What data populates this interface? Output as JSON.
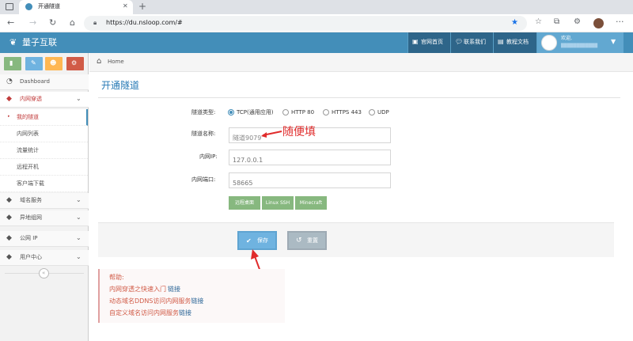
{
  "browser": {
    "tab_title": "开通隧道",
    "url": "https://du.nsloop.com/#"
  },
  "header": {
    "brand": "量子互联",
    "links": [
      "官网首页",
      "联系我们",
      "教程文档"
    ],
    "welcome": "欢迎,",
    "username": "████████████"
  },
  "sidebar": {
    "items": [
      {
        "label": "Dashboard"
      },
      {
        "label": "内网穿透"
      },
      {
        "label": "域名服务"
      },
      {
        "label": "异地组网"
      },
      {
        "label": "公网 IP"
      },
      {
        "label": "用户中心"
      }
    ],
    "subitems": [
      "我的隧道",
      "内网列表",
      "流量统计",
      "远程开机",
      "客户端下载"
    ]
  },
  "breadcrumb": {
    "home": "Home"
  },
  "page": {
    "title": "开通隧道"
  },
  "form": {
    "type_label": "隧道类型:",
    "types": [
      "TCP(通用应用)",
      "HTTP 80",
      "HTTPS 443",
      "UDP"
    ],
    "name_label": "隧道名称:",
    "name_value": "隧道9079",
    "ip_label": "内网IP:",
    "ip_placeholder": "127.0.0.1",
    "port_label": "内网端口:",
    "port_placeholder": "58665",
    "presets": [
      "远程桌面",
      "Linux SSH",
      "Minecraft"
    ],
    "save": "保存",
    "reset": "重置"
  },
  "annotation": {
    "text": "随便填"
  },
  "help": {
    "title": "帮助:",
    "lines": [
      {
        "text": "内网穿透之快速入门",
        "link": "链接"
      },
      {
        "text": "动态域名DDNS访问内网服务",
        "link": "链接"
      },
      {
        "text": "自定义域名访问内网服务",
        "link": "链接"
      }
    ]
  },
  "colors": {
    "header": "#438eb9",
    "active_nav": "#c13c3c",
    "green": "#87b87f",
    "primary": "#6fb3e0",
    "annotation": "#e02b2b"
  }
}
